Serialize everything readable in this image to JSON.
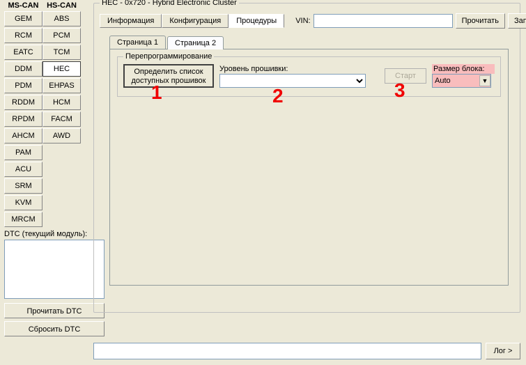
{
  "columns": {
    "mscan_header": "MS-CAN",
    "hscan_header": "HS-CAN",
    "mscan": [
      "GEM",
      "RCM",
      "EATC",
      "DDM",
      "PDM",
      "RDDM",
      "RPDM",
      "AHCM",
      "PAM",
      "ACU",
      "SRM",
      "KVM",
      "MRCM"
    ],
    "hscan": [
      "ABS",
      "PCM",
      "TCM",
      "HEC",
      "EHPAS",
      "HCM",
      "FACM",
      "AWD"
    ],
    "hscan_selected": "HEC"
  },
  "dtc": {
    "label": "DTC (текущий модуль):",
    "read_btn": "Прочитать DTC",
    "clear_btn": "Сбросить DTC"
  },
  "main": {
    "title": "HEC - 0x720 - Hybrid Electronic Cluster",
    "tabs": {
      "info": "Информация",
      "config": "Конфигурация",
      "proc": "Процедуры"
    },
    "active_tab": "proc",
    "vin_label": "VIN:",
    "vin_value": "",
    "read_btn": "Прочитать",
    "write_btn": "Записать"
  },
  "pages": {
    "p1": "Страница 1",
    "p2": "Страница 2",
    "active": "p2"
  },
  "reprogram": {
    "legend": "Перепрограммирование",
    "detect_btn_l1": "Определить список",
    "detect_btn_l2": "доступных прошивок",
    "fw_label": "Уровень прошивки:",
    "fw_value": "",
    "start_btn": "Старт",
    "block_label": "Размер блока:",
    "block_value": "Auto"
  },
  "overlays": {
    "n1": "1",
    "n2": "2",
    "n3": "3"
  },
  "footer": {
    "input_value": "",
    "log_btn": "Лог >"
  }
}
